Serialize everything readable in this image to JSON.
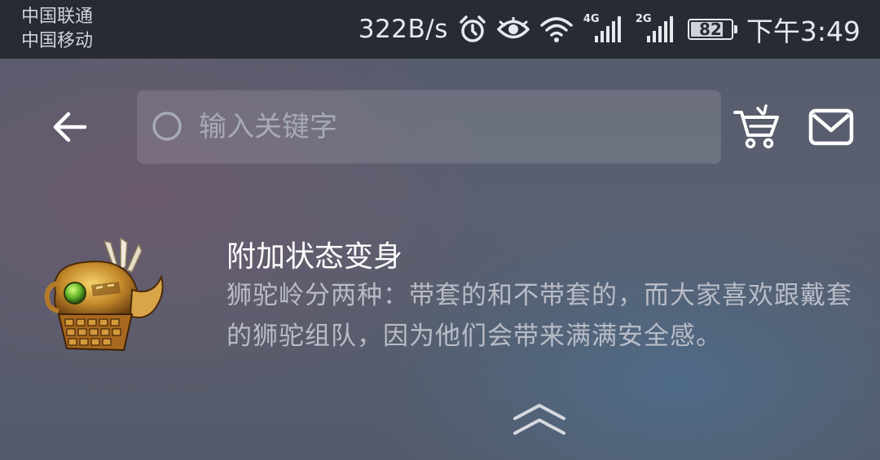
{
  "status_bar": {
    "carrier_1": "中国联通",
    "carrier_2": "中国移动",
    "net_speed": "322B/s",
    "signal_1_label": "4G",
    "signal_2_label": "2G",
    "battery": "82",
    "battery_level": 0.82,
    "time": "下午3:49",
    "icons": [
      "alarm-icon",
      "eye-icon",
      "wifi-icon",
      "signal-4g-icon",
      "signal-2g-icon",
      "battery-icon"
    ]
  },
  "header": {
    "search_placeholder": "输入关键字",
    "icons": [
      "back-arrow-icon",
      "search-icon",
      "cart-icon",
      "mail-icon"
    ]
  },
  "item": {
    "title": "附加状态变身",
    "description": "狮驼岭分两种：带套的和不带套的，而大家喜欢跟戴套的狮驼组队，因为他们会带来满满安全感。",
    "icon": "helmet-item-icon"
  },
  "footer": {
    "icon": "double-chevron-up-icon"
  },
  "colors": {
    "status_bar_bg": "#272b33",
    "background": "#565b6c",
    "title_text": "#ffffff",
    "description_text": "#b9bcc6"
  }
}
